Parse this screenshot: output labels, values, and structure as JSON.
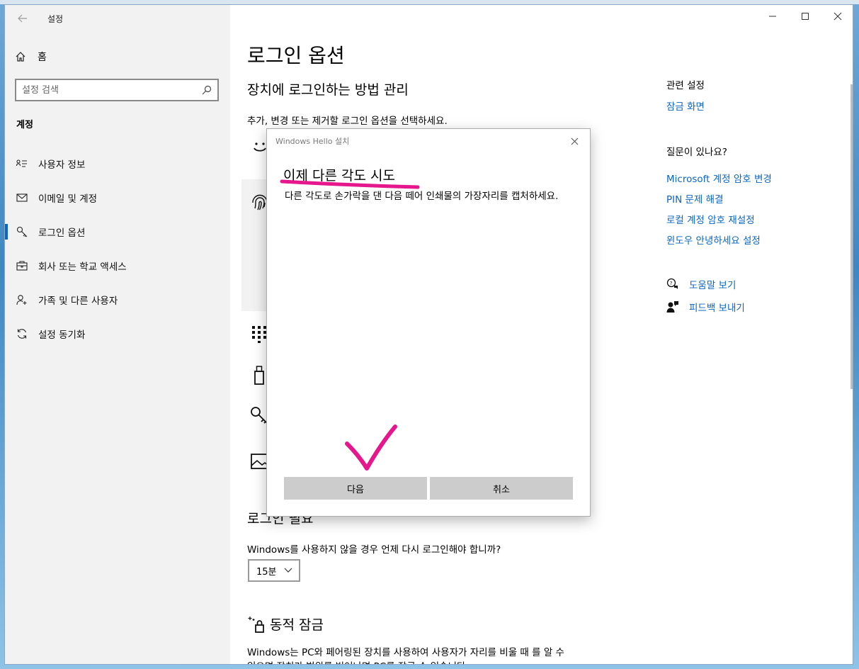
{
  "app": {
    "title": "설정"
  },
  "sidebar": {
    "home_label": "홈",
    "search_placeholder": "설정 검색",
    "section": "계정",
    "items": [
      {
        "label": "사용자 정보",
        "icon": "person-card-icon"
      },
      {
        "label": "이메일 및 계정",
        "icon": "mail-icon"
      },
      {
        "label": "로그인 옵션",
        "icon": "key-icon",
        "active": true
      },
      {
        "label": "회사 또는 학교 액세스",
        "icon": "briefcase-icon"
      },
      {
        "label": "가족 및 다른 사용자",
        "icon": "person-add-icon"
      },
      {
        "label": "설정 동기화",
        "icon": "sync-icon"
      }
    ]
  },
  "main": {
    "title": "로그인 옵션",
    "subtitle": "장치에 로그인하는 방법 관리",
    "description": "추가, 변경 또는 제거할 로그인 옵션을 선택하세요.",
    "signin_required_heading": "로그인 필요",
    "signin_question": "Windows를 사용하지 않을 경우 언제 다시 로그인해야 합니까?",
    "timeout_value": "15분",
    "dynamic_lock_heading": "동적 잠금",
    "dynamic_lock_desc": "Windows는 PC와 페어링된 장치를 사용하여 사용자가 자리를 비울 때 를 알 수 있으면 장치가 범위를 벗어나면 PC를 잠글 수 있습니다"
  },
  "related": {
    "heading": "관련 설정",
    "lock_screen": "잠금 화면"
  },
  "help": {
    "heading": "질문이 있나요?",
    "links": [
      "Microsoft 계정 암호 변경",
      "PIN 문제 해결",
      "로컬 계정 암호 재설정",
      "윈도우 안녕하세요 설정"
    ]
  },
  "support": {
    "help_label": "도움말 보기",
    "feedback_label": "피드백 보내기"
  },
  "dialog": {
    "title": "Windows Hello 설치",
    "heading": "이제 다른 각도 시도",
    "text": "다른 각도로 손가락을 댄 다음 떼어 인쇄물의 가장자리를 캡처하세요.",
    "next_label": "다음",
    "cancel_label": "취소"
  },
  "colors": {
    "accent": "#0a66c2",
    "annotation": "#e6168c",
    "button_gray": "#cccccc"
  }
}
